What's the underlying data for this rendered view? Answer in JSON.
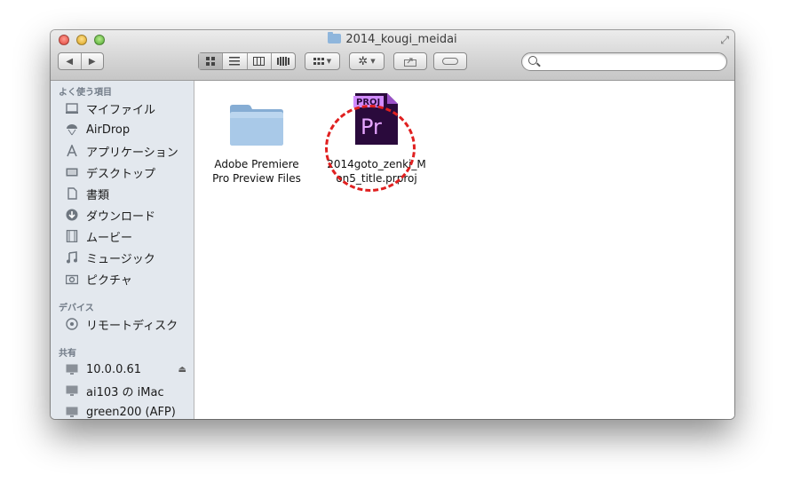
{
  "window": {
    "title": "2014_kougi_meidai"
  },
  "toolbar": {
    "back_icon": "back-arrow-icon",
    "forward_icon": "forward-arrow-icon",
    "view_modes": [
      "icon-view",
      "list-view",
      "column-view",
      "coverflow-view"
    ],
    "arrange_icon": "arrange-grid-icon",
    "action_icon": "gear-icon",
    "share_icon": "share-icon",
    "tags_icon": "tag-pill-icon",
    "search_placeholder": ""
  },
  "sidebar": {
    "favorites_header": "よく使う項目",
    "favorites": [
      {
        "label": "マイファイル",
        "icon": "all-files-icon"
      },
      {
        "label": "AirDrop",
        "icon": "airdrop-icon"
      },
      {
        "label": "アプリケーション",
        "icon": "applications-icon"
      },
      {
        "label": "デスクトップ",
        "icon": "desktop-icon"
      },
      {
        "label": "書類",
        "icon": "documents-icon"
      },
      {
        "label": "ダウンロード",
        "icon": "downloads-icon"
      },
      {
        "label": "ムービー",
        "icon": "movies-icon"
      },
      {
        "label": "ミュージック",
        "icon": "music-icon"
      },
      {
        "label": "ピクチャ",
        "icon": "camera-icon"
      }
    ],
    "devices_header": "デバイス",
    "devices": [
      {
        "label": "リモートディスク",
        "icon": "remote-disc-icon"
      }
    ],
    "shared_header": "共有",
    "shared": [
      {
        "label": "10.0.0.61",
        "icon": "network-computer-icon",
        "eject": "⏏"
      },
      {
        "label": "ai103 の iMac",
        "icon": "network-computer-icon"
      },
      {
        "label": "green200 (AFP)",
        "icon": "network-computer-icon"
      }
    ]
  },
  "files": [
    {
      "name_line1": "Adobe Premiere",
      "name_line2": "Pro Preview Files",
      "type": "folder"
    },
    {
      "name_line1": "2014goto_zenki_M",
      "name_line2": "on5_title.prproj",
      "type": "premiere-project",
      "badge": "PROJ",
      "logo": "Pr"
    }
  ],
  "colors": {
    "sidebar_bg": "#e3e8ee",
    "folder_blue": "#8fb6dc",
    "premiere_purple": "#2a0a3c",
    "premiere_text": "#e6a6ff",
    "annotation_red": "#e02020"
  }
}
